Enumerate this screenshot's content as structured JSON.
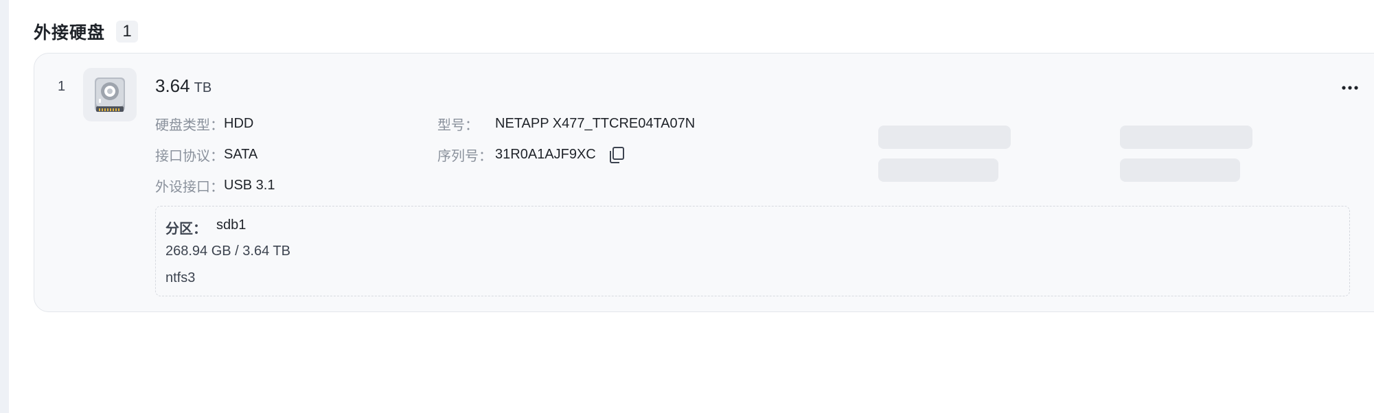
{
  "section": {
    "title": "外接硬盘",
    "count": "1"
  },
  "disk": {
    "index": "1",
    "icon": "hard-disk-icon",
    "capacity_value": "3.64",
    "capacity_unit": "TB",
    "details": {
      "type_label": "硬盘类型：",
      "type_value": "HDD",
      "protocol_label": "接口协议：",
      "protocol_value": "SATA",
      "port_label": "外设接口：",
      "port_value": "USB 3.1",
      "model_label": "型号：",
      "model_value": "NETAPP X477_TTCRE04TA07N",
      "serial_label": "序列号：",
      "serial_value": "31R0A1AJF9XC"
    },
    "partition": {
      "label": "分区：",
      "name": "sdb1",
      "usage": "268.94 GB / 3.64 TB",
      "filesystem": "ntfs3"
    }
  },
  "colors": {
    "card_background": "#f8f9fb",
    "skeleton": "#e8eaee",
    "label_text": "#8a919c",
    "value_text": "#1f2329"
  }
}
